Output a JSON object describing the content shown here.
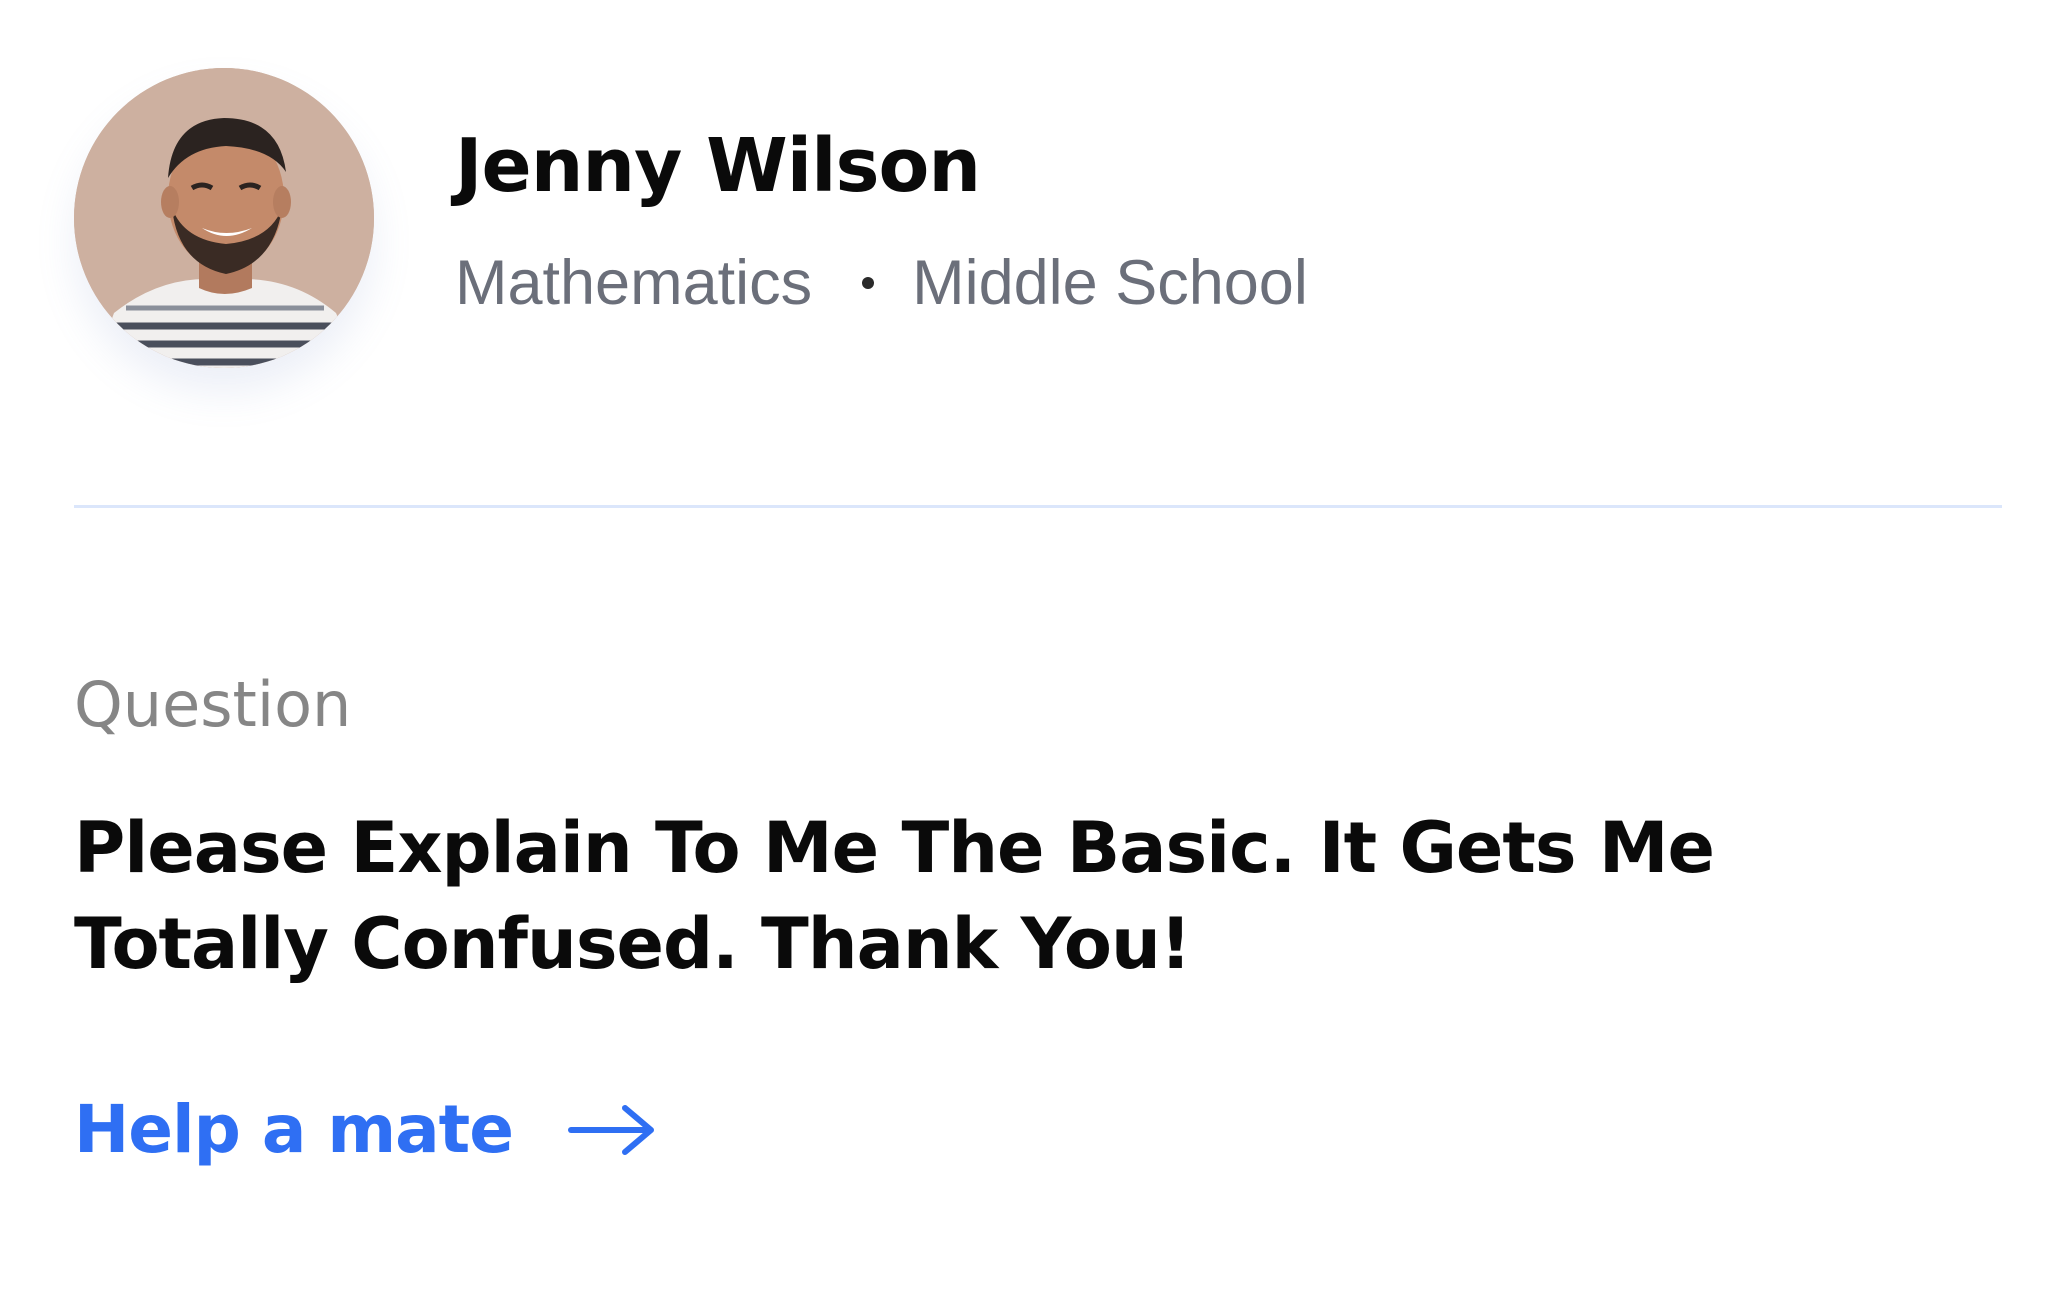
{
  "profile": {
    "name": "Jenny Wilson",
    "subject": "Mathematics",
    "level": "Middle School",
    "avatar_icon": "user-photo"
  },
  "question": {
    "label": "Question",
    "text": "Please Explain To Me The Basic. It Gets Me Totally Confused. Thank You!"
  },
  "action": {
    "label": "Help a mate",
    "icon": "arrow-right-icon"
  },
  "colors": {
    "accent": "#2f6ff3",
    "divider": "#dbe6fb",
    "muted_text": "#6b6f7a",
    "label_text": "#868686",
    "primary_text": "#0a0a0a"
  }
}
